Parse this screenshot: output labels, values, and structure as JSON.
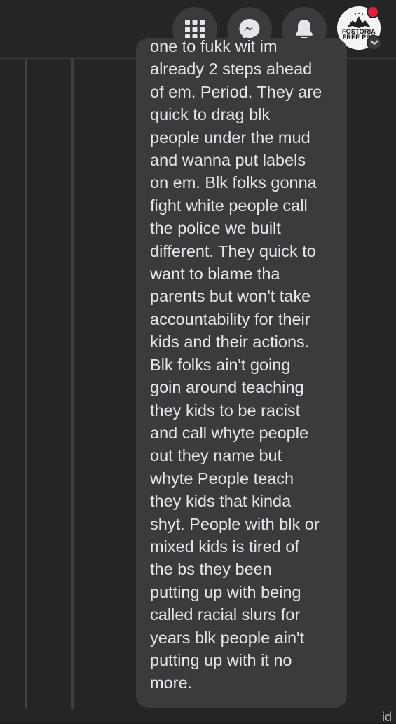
{
  "header": {
    "menu_icon": "grid-menu-icon",
    "messenger_icon": "messenger-icon",
    "notifications_icon": "bell-icon",
    "profile": {
      "avatar_text_line1": "FOSTORIA",
      "avatar_text_line2": "FREE PRE",
      "notification_dot_color": "#e41e3f",
      "dropdown_icon": "chevron-down-icon"
    }
  },
  "comment": {
    "lines": [
      "one to fukk wit im",
      "already 2 steps ahead",
      "of em. Period. They are",
      "quick to drag blk",
      "people under the mud",
      "and wanna put labels",
      "on em. Blk folks gonna",
      "fight white people call",
      "the police we built",
      "different. They quick to",
      "want to blame tha",
      "parents but won't take",
      "accountability for their",
      "kids and their actions.",
      "Blk folks ain't going",
      "goin around teaching",
      "they kids to be racist",
      "and call whyte people",
      "out they name but",
      "whyte People teach",
      "they kids that kinda",
      "shyt. People with blk or",
      "mixed kids is tired of",
      "the bs they been",
      "putting up with being",
      "called racial slurs for",
      "years blk people ain't",
      "putting up with it no",
      "more."
    ]
  },
  "footer": {
    "partial_text": "id"
  }
}
